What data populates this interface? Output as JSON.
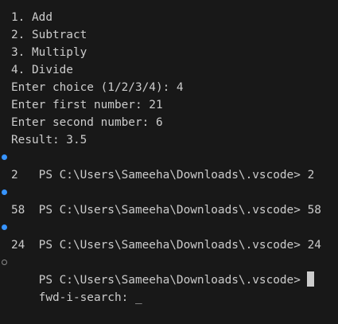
{
  "terminal": {
    "colors": {
      "background": "#181818",
      "foreground": "#cccccc",
      "decoration_success": "#3794ff",
      "decoration_default": "#8a8a8a"
    },
    "program_output": [
      "1. Add",
      "2. Subtract",
      "3. Multiply",
      "4. Divide",
      "Enter choice (1/2/3/4): 4",
      "Enter first number: 21",
      "Enter second number: 6",
      "Result: 3.5"
    ],
    "prompt": "PS C:\\Users\\Sameeha\\Downloads\\.vscode>",
    "commands": [
      {
        "input": "2",
        "output": "2"
      },
      {
        "input": "58",
        "output": "58"
      },
      {
        "input": "24",
        "output": "24"
      }
    ],
    "current_input": "",
    "search": {
      "label": "fwd-i-search:",
      "query": "_"
    }
  }
}
